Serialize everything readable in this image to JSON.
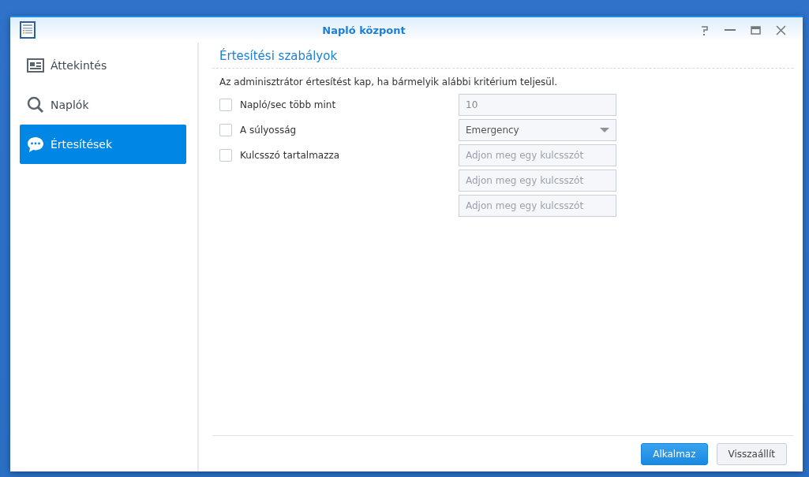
{
  "window": {
    "title": "Napló központ"
  },
  "sidebar": {
    "items": [
      {
        "label": "Áttekintés",
        "selected": false
      },
      {
        "label": "Naplók",
        "selected": false
      },
      {
        "label": "Értesítések",
        "selected": true
      }
    ]
  },
  "section": {
    "title": "Értesítési szabályok",
    "description": "Az adminisztrátor értesítést kap, ha bármelyik alábbi kritérium teljesül."
  },
  "criteria": [
    {
      "label": "Napló/sec több mint",
      "checked": false
    },
    {
      "label": "A súlyosság",
      "checked": false
    },
    {
      "label": "Kulcsszó tartalmazza",
      "checked": false
    }
  ],
  "fields": [
    {
      "kind": "text",
      "value": "10"
    },
    {
      "kind": "select",
      "value": "Emergency"
    },
    {
      "kind": "text",
      "placeholder": "Adjon meg egy kulcsszót"
    },
    {
      "kind": "text",
      "placeholder": "Adjon meg egy kulcsszót"
    },
    {
      "kind": "text",
      "placeholder": "Adjon meg egy kulcsszót"
    }
  ],
  "buttons": [
    {
      "label": "Alkalmaz",
      "kind": "primary"
    },
    {
      "label": "Visszaállít",
      "kind": "secondary"
    }
  ]
}
